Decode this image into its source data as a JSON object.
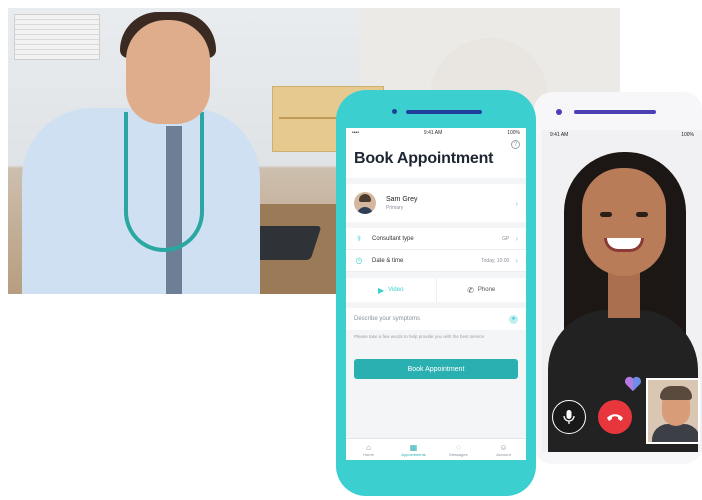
{
  "booking": {
    "status_time": "9:41 AM",
    "status_carrier": "•••• ",
    "status_battery": "100%",
    "title": "Book Appointment",
    "doctor": {
      "name": "Sam Grey",
      "role": "Primary"
    },
    "options": [
      {
        "icon": "stethoscope-icon",
        "label": "Consultant type",
        "value": "GP"
      },
      {
        "icon": "clock-icon",
        "label": "Date & time",
        "value": "Today, 10:00"
      }
    ],
    "modes": [
      {
        "icon": "video-icon",
        "label": "Video",
        "active": true
      },
      {
        "icon": "phone-icon",
        "label": "Phone",
        "active": false
      }
    ],
    "symptom_placeholder": "Describe your symptoms",
    "symptom_hint": "Please take a few words to help provide you with the best service",
    "book_button": "Book Appointment",
    "tabs": [
      {
        "icon": "home-icon",
        "label": "Home"
      },
      {
        "icon": "calendar-icon",
        "label": "Appointments",
        "active": true
      },
      {
        "icon": "chat-icon",
        "label": "Messages"
      },
      {
        "icon": "profile-icon",
        "label": "Account"
      }
    ]
  },
  "video_call": {
    "status_time": "9:41 AM",
    "status_battery": "100%"
  },
  "colors": {
    "accent": "#3ccfd0",
    "button": "#2bb0b1",
    "end_call": "#e8363d",
    "phone_accent": "#4b3fb3"
  }
}
